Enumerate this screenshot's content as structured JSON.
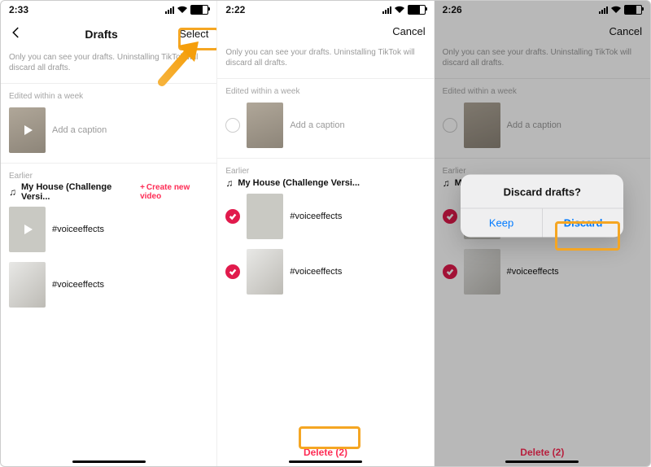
{
  "shared": {
    "note": "Only you can see your drafts. Uninstalling TikTok will discard all drafts.",
    "sectionRecent": "Edited within a week",
    "sectionEarlier": "Earlier",
    "addCaption": "Add a caption",
    "music": "My House (Challenge Versi...",
    "hash": "#voiceeffects"
  },
  "s1": {
    "time": "2:33",
    "title": "Drafts",
    "action": "Select",
    "createNew": "Create new video"
  },
  "s2": {
    "time": "2:22",
    "action": "Cancel",
    "delete": "Delete (2)"
  },
  "s3": {
    "time": "2:26",
    "dialogTitle": "Discard drafts?",
    "keep": "Keep",
    "discard": "Discard"
  }
}
